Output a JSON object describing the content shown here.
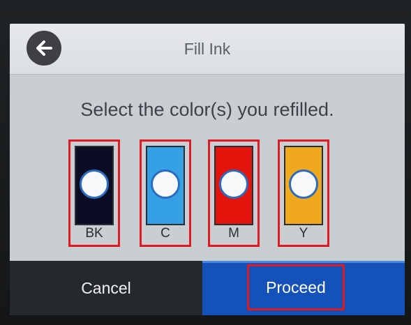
{
  "header": {
    "title": "Fill Ink",
    "back_icon": "arrow-left-icon"
  },
  "prompt": "Select the color(s) you refilled.",
  "inks": [
    {
      "code": "BK",
      "color": "#0b0d24",
      "selected": false
    },
    {
      "code": "C",
      "color": "#35a0e6",
      "selected": false
    },
    {
      "code": "M",
      "color": "#e3140b",
      "selected": false
    },
    {
      "code": "Y",
      "color": "#f0a91f",
      "selected": false
    }
  ],
  "actions": {
    "cancel_label": "Cancel",
    "proceed_label": "Proceed"
  },
  "colors": {
    "highlight": "#e01a22",
    "proceed_bg": "#1451b9",
    "cancel_bg": "#25282c"
  }
}
